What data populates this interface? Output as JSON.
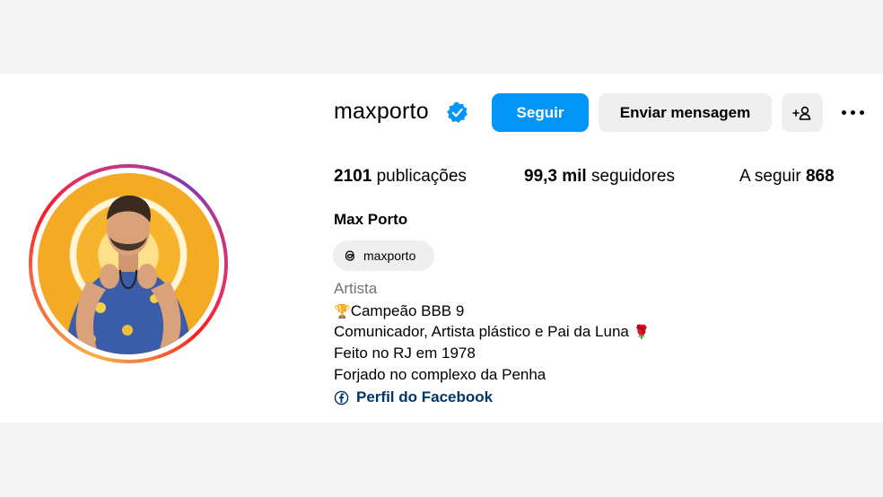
{
  "profile": {
    "username": "maxporto",
    "full_name": "Max Porto",
    "verified": true,
    "verified_icon": "verified-badge-icon",
    "brand_color": "#0095f6"
  },
  "actions": {
    "follow_label": "Seguir",
    "message_label": "Enviar mensagem",
    "suggest_icon": "person-add-icon",
    "more_icon": "more-options-icon"
  },
  "stats": {
    "posts_value": "2101",
    "posts_label": "publicações",
    "followers_value": "99,3 mil",
    "followers_label": "seguidores",
    "following_label": "A seguir",
    "following_value": "868"
  },
  "threads": {
    "handle": "maxporto",
    "icon": "threads-icon"
  },
  "category": "Artista",
  "bio": {
    "line1_emoji": "🏆",
    "line1_text": "Campeão BBB 9",
    "line2_text": "Comunicador, Artista plástico e Pai da Luna",
    "line2_emoji": "🌹",
    "line3_text": "Feito no RJ em 1978",
    "line4_text": "Forjado no complexo da Penha"
  },
  "facebook_link": {
    "label": "Perfil do Facebook",
    "icon": "facebook-icon"
  }
}
